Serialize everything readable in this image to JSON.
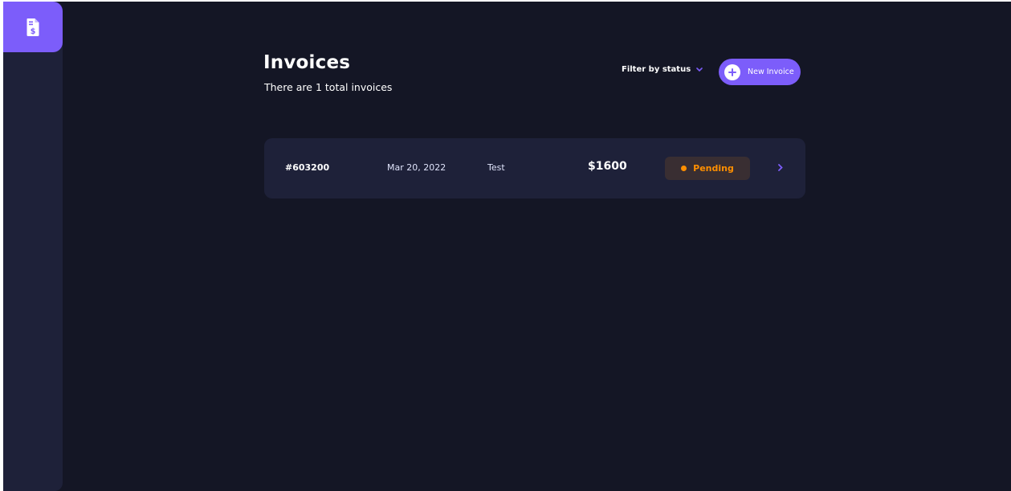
{
  "colors": {
    "accent": "#7c5dfa",
    "background": "#141625",
    "surface": "#1e2139",
    "pending": "#ff8f00"
  },
  "sidebar": {
    "logo_icon": "invoice-dollar-icon"
  },
  "header": {
    "title": "Invoices",
    "subtitle": "There are 1 total invoices",
    "filter_label": "Filter by status",
    "filter_icon": "chevron-down-icon",
    "new_invoice_label": "New Invoice",
    "new_invoice_icon": "plus-icon"
  },
  "invoices": [
    {
      "id": "#603200",
      "date": "Mar 20, 2022",
      "client": "Test",
      "amount": "$1600",
      "status": "Pending",
      "arrow_icon": "chevron-right-icon"
    }
  ]
}
